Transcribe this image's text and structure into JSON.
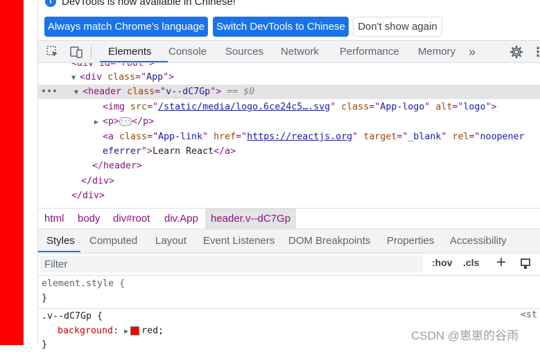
{
  "infobar": {
    "message": "DevTools is now available in Chinese!",
    "buttons": {
      "always_match": "Always match Chrome's language",
      "switch": "Switch DevTools to Chinese",
      "dont_show": "Don't show again"
    }
  },
  "main_tabs": [
    "Elements",
    "Console",
    "Sources",
    "Network",
    "Performance",
    "Memory"
  ],
  "main_tabs_more": "»",
  "dom": {
    "line0": "<div id=\"root\">",
    "app_open": {
      "tag": "<div ",
      "attr": "class",
      "eq": "=\"",
      "val": "App",
      "close": "\">"
    },
    "header_open": {
      "tag": "<header ",
      "attr": "class",
      "val": "v--dC7Gp",
      "suffix": "== $0"
    },
    "img": {
      "tag": "<img ",
      "src_attr": "src",
      "src_val": "/static/media/logo.6ce24c5….svg",
      "class_attr": "class",
      "class_val": "App-logo",
      "alt_attr": "alt",
      "alt_val": "logo",
      "end": ">"
    },
    "p": {
      "open": "<p>",
      "close": "</p>"
    },
    "a": {
      "tag": "<a ",
      "class_attr": "class",
      "class_val": "App-link",
      "href_attr": "href",
      "href_val": "https://reactjs.org",
      "target_attr": "target",
      "target_val": "_blank",
      "rel_attr": "rel",
      "rel_val_1": "noopener",
      "rel_val_2": "eferrer",
      "text": "Learn React",
      "close": "</a>"
    },
    "header_close": "</header>",
    "div_close_1": "</div>",
    "div_close_2": "</div>"
  },
  "breadcrumb": [
    "html",
    "body",
    "div#root",
    "div.App",
    "header.v--dC7Gp"
  ],
  "style_tabs": [
    "Styles",
    "Computed",
    "Layout",
    "Event Listeners",
    "DOM Breakpoints",
    "Properties",
    "Accessibility"
  ],
  "filter": {
    "placeholder": "Filter",
    "hov": ":hov",
    "cls": ".cls",
    "plus": "+"
  },
  "rules": {
    "element_style": "element.style {",
    "element_close": "}",
    "selector": ".v--dC7Gp {",
    "prop": "background",
    "value": "red",
    "source": "<st",
    "close": "}"
  },
  "watermark": "CSDN @崽崽的谷雨",
  "colors": {
    "accent": "#1a73e8",
    "tag": "#881280",
    "attr": "#994500",
    "value": "#1a1aa6",
    "swatch": "#ff0000"
  }
}
